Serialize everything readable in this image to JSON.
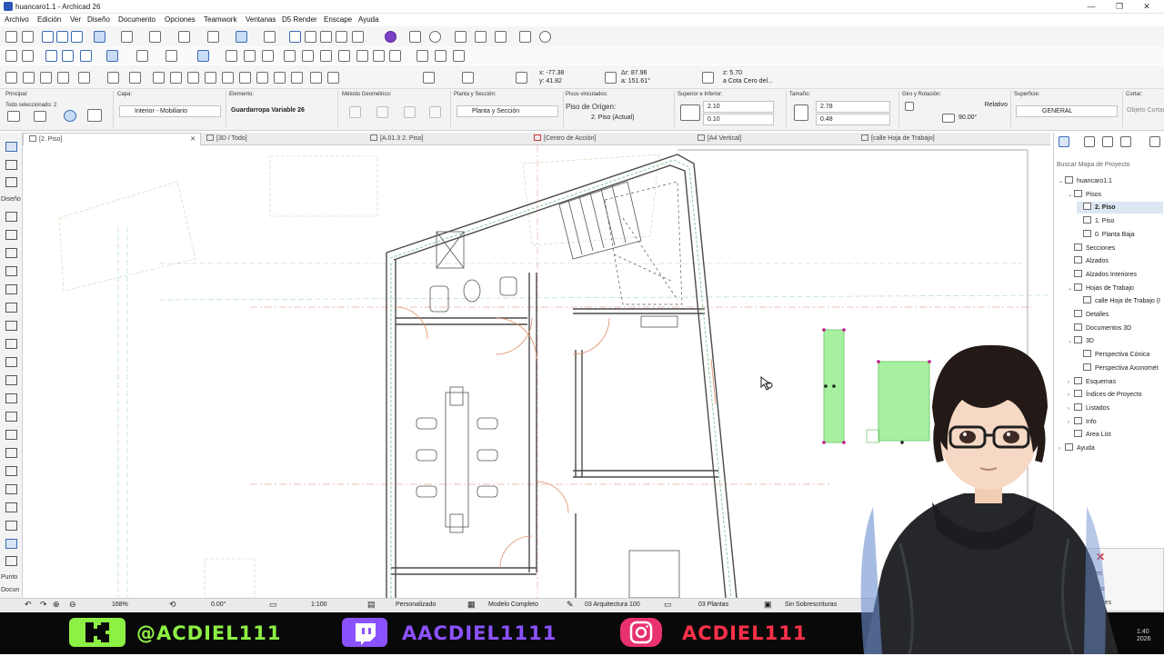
{
  "window": {
    "title": "huancaro1.1 - Archicad 26",
    "minimize": "—",
    "restore": "❐",
    "close": "✕"
  },
  "menu": [
    "Archivo",
    "Edición",
    "Ver",
    "Diseño",
    "Documento",
    "Opciones",
    "Teamwork",
    "Ventanas",
    "D5 Render",
    "Enscape",
    "Ayuda"
  ],
  "coords": {
    "x": "x: -77.38",
    "y": "y: 41.82",
    "dr": "Δr: 87.96",
    "angle": "a: 151.61°",
    "z": "z: 5.70",
    "zref": "a Cota Cero del..."
  },
  "infobox": {
    "principal_label": "Principal:",
    "selection": "Todo seleccionado: 2",
    "capa_label": "Capa:",
    "capa_value": "Interior - Mobiliario",
    "elemento_label": "Elemento:",
    "elemento_value": "Guardarropa Variable 26",
    "metodo_label": "Método Geométrico:",
    "planta_label": "Planta y Sección:",
    "planta_value": "Planta y Sección",
    "pisos_label": "Pisos vinculados:",
    "piso_origen_label": "Piso de Origen:",
    "piso_origen_value": "2. Piso (Actual)",
    "sup_inf_label": "Superior e Inferior:",
    "sup_value": "2.10",
    "inf_value": "0.10",
    "tamano_label": "Tamaño:",
    "size_a": "2.78",
    "size_b": "0.48",
    "giro_label": "Giro y Rotación:",
    "giro_rel": "Relativo",
    "giro_angle": "90.00°",
    "superficie_label": "Superficie:",
    "superficie_value": "GENERAL",
    "cortar_label": "Cortar:",
    "cortar_value": "Objeto Cortado"
  },
  "tabs": [
    {
      "label": "[2. Piso]",
      "close": "✕"
    },
    {
      "label": "[3D / Todo]"
    },
    {
      "label": "[A.01.3 2. Piso]"
    },
    {
      "label": "[Centro de Acción]"
    },
    {
      "label": "[A4 Vertical]"
    },
    {
      "label": "[calle Hoja de Trabajo]"
    }
  ],
  "toolbox": {
    "diseno": "Diseño",
    "punto": "Punto",
    "docu": "Docun"
  },
  "navigator": {
    "search_placeholder": "Buscar Mapa de Proyecto",
    "nodes": [
      {
        "label": "huancaro1.1",
        "level": 0,
        "twisty": "⌄"
      },
      {
        "label": "Pisos",
        "level": 1,
        "twisty": "⌄"
      },
      {
        "label": "2. Piso",
        "level": 2,
        "twisty": ""
      },
      {
        "label": "1. Piso",
        "level": 2,
        "twisty": ""
      },
      {
        "label": "0. Planta Baja",
        "level": 2,
        "twisty": ""
      },
      {
        "label": "Secciones",
        "level": 1,
        "twisty": ""
      },
      {
        "label": "Alzados",
        "level": 1,
        "twisty": ""
      },
      {
        "label": "Alzados Interiores",
        "level": 1,
        "twisty": ""
      },
      {
        "label": "Hojas de Trabajo",
        "level": 1,
        "twisty": "⌄"
      },
      {
        "label": "calle Hoja de Trabajo (I",
        "level": 2,
        "twisty": ""
      },
      {
        "label": "Detalles",
        "level": 1,
        "twisty": ""
      },
      {
        "label": "Documentos 3D",
        "level": 1,
        "twisty": ""
      },
      {
        "label": "3D",
        "level": 1,
        "twisty": "⌄"
      },
      {
        "label": "Perspectiva Cónica",
        "level": 2,
        "twisty": ""
      },
      {
        "label": "Perspectiva Axonomét",
        "level": 2,
        "twisty": ""
      },
      {
        "label": "Esquemas",
        "level": 1,
        "twisty": "›"
      },
      {
        "label": "Índices de Proyecto",
        "level": 1,
        "twisty": "›"
      },
      {
        "label": "Listados",
        "level": 1,
        "twisty": "›"
      },
      {
        "label": "Info",
        "level": 1,
        "twisty": "›"
      },
      {
        "label": "Area List",
        "level": 1,
        "twisty": ""
      },
      {
        "label": "Ayuda",
        "level": 0,
        "twisty": "›"
      }
    ]
  },
  "overlay_panel": {
    "close": "✕",
    "row1": "edades",
    "row2": "Piso",
    "row3": "efiniciones"
  },
  "status": {
    "zoom": "168%",
    "angle": "0.00°",
    "scale": "1:100",
    "layer_combo": "Personalizado",
    "model_view": "Modelo Completo",
    "pen_set": "03 Arquitectura 100",
    "dimension": "03 Plantas",
    "overrides": "Sin Sobrescrituras"
  },
  "stream": {
    "kick": "@ACDIEL111",
    "twitch": "AACDIEL1111",
    "instagram": "ACDIEL111",
    "kick_color": "#8df044",
    "twitch_color": "#8a52ff",
    "instagram_color": "#ff3049"
  },
  "clock": {
    "time": "1:40",
    "year": "2026"
  },
  "colors": {
    "accent": "#3b6bb3",
    "selection_fill": "#a6f0a0",
    "selection_handle": "#c0188a"
  }
}
